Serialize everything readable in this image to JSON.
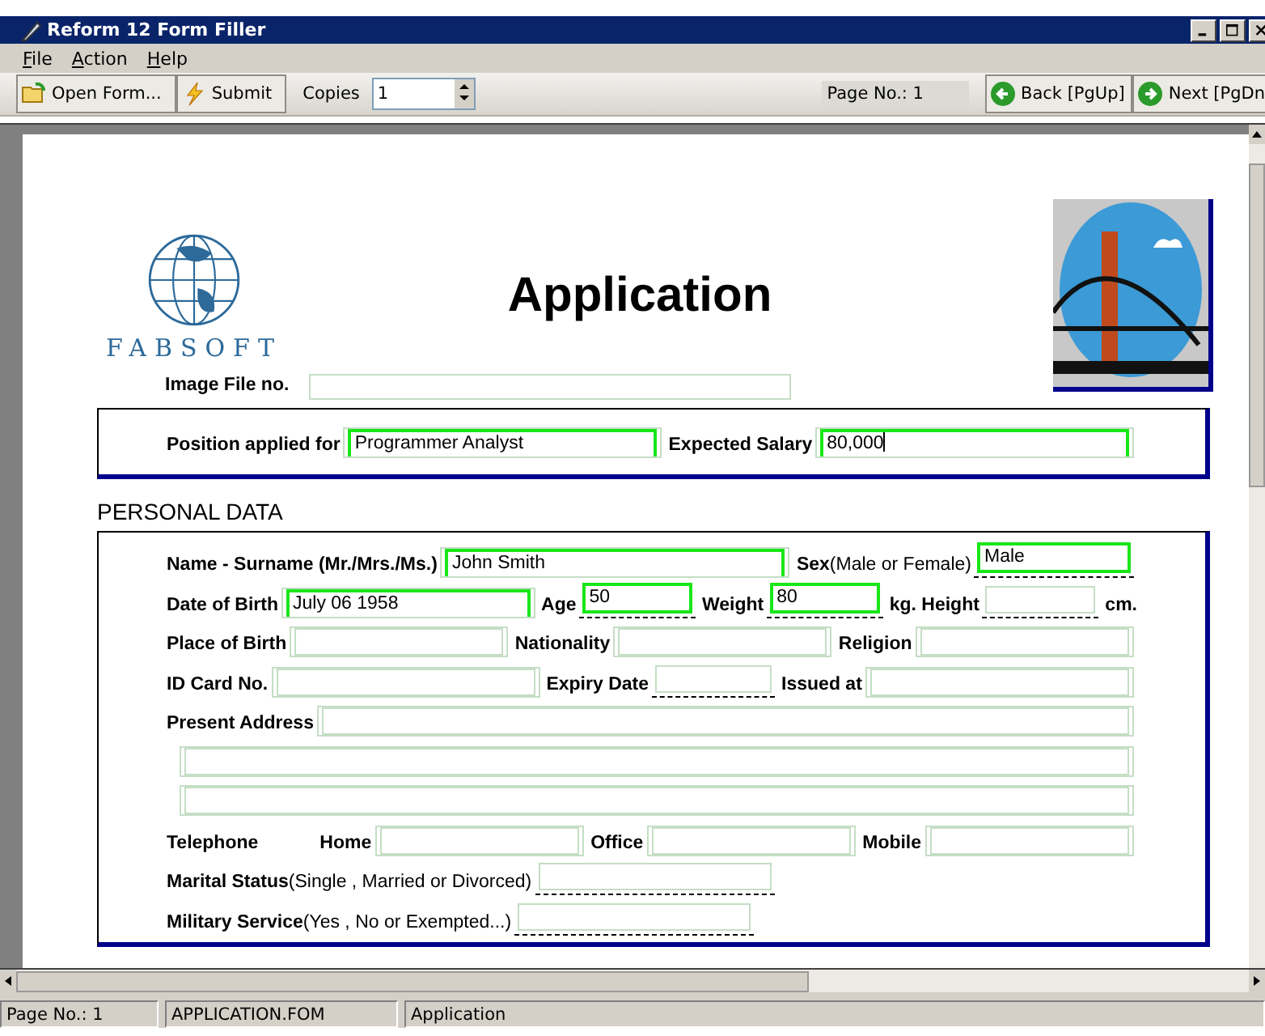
{
  "window": {
    "title": "Reform 12 Form Filler"
  },
  "menu": [
    {
      "label": "File"
    },
    {
      "label": "Action"
    },
    {
      "label": "Help"
    }
  ],
  "toolbar": {
    "open_button": "Open Form...",
    "submit_button": "Submit",
    "copies_label": "Copies",
    "copies_value": "1",
    "page_indicator": "Page No.: 1",
    "back_button": "Back [PgUp]",
    "next_button": "Next [PgDn"
  },
  "form": {
    "logo_text": "FABSOFT",
    "title": "Application",
    "image_file_label": "Image File no.",
    "position_row": [
      {
        "kind": "label",
        "text": "Position applied for"
      },
      {
        "kind": "field",
        "value": "Programmer Analyst"
      },
      {
        "kind": "label",
        "text": "Expected Salary"
      },
      {
        "kind": "field",
        "value": "80,000",
        "cursor": true
      }
    ],
    "section_heading": "PERSONAL DATA",
    "rows": [
      {
        "items": [
          {
            "kind": "label",
            "text": "Name - Surname (Mr./Mrs./Ms.)"
          },
          {
            "kind": "field",
            "value": "John Smith"
          },
          {
            "kind": "label",
            "text": "Sex",
            "note": "(Male or Female)"
          },
          {
            "kind": "small-field",
            "value": "Male"
          }
        ]
      },
      {
        "items": [
          {
            "kind": "label",
            "text": "Date of Birth"
          },
          {
            "kind": "field",
            "value": "July 06 1958"
          },
          {
            "kind": "label",
            "text": "Age"
          },
          {
            "kind": "small-field",
            "value": "50"
          },
          {
            "kind": "label",
            "text": "Weight"
          },
          {
            "kind": "small-field",
            "value": "80"
          },
          {
            "kind": "label",
            "text": "kg.  Height"
          },
          {
            "kind": "small-field"
          },
          {
            "kind": "label",
            "text": "cm."
          }
        ]
      },
      {
        "items": [
          {
            "kind": "label",
            "text": "Place of Birth"
          },
          {
            "kind": "field"
          },
          {
            "kind": "label",
            "text": "Nationality"
          },
          {
            "kind": "field"
          },
          {
            "kind": "label",
            "text": "Religion"
          },
          {
            "kind": "field"
          }
        ]
      },
      {
        "items": [
          {
            "kind": "label",
            "text": "ID Card No."
          },
          {
            "kind": "field"
          },
          {
            "kind": "label",
            "text": "Expiry Date"
          },
          {
            "kind": "small-field"
          },
          {
            "kind": "label",
            "text": "Issued at"
          },
          {
            "kind": "field"
          }
        ]
      },
      {
        "items": [
          {
            "kind": "label",
            "text": "Present Address"
          },
          {
            "kind": "field"
          }
        ]
      },
      {
        "items": [
          {
            "kind": "field"
          }
        ]
      },
      {
        "items": [
          {
            "kind": "field"
          }
        ]
      },
      {
        "items": [
          {
            "kind": "label",
            "text": "Telephone"
          },
          {
            "kind": "label",
            "text": "Home"
          },
          {
            "kind": "field"
          },
          {
            "kind": "label",
            "text": "Office"
          },
          {
            "kind": "field"
          },
          {
            "kind": "label",
            "text": "Mobile"
          },
          {
            "kind": "field"
          }
        ]
      },
      {
        "items": [
          {
            "kind": "label",
            "text": "Marital Status",
            "note": "(Single , Married or Divorced)"
          },
          {
            "kind": "short-field"
          }
        ]
      },
      {
        "items": [
          {
            "kind": "label",
            "text": "Military Service",
            "note": "(Yes , No or Exempted...)"
          },
          {
            "kind": "short-field"
          }
        ]
      }
    ]
  },
  "status_bar": [
    {
      "text": "Page No.: 1"
    },
    {
      "text": "APPLICATION.FOM"
    },
    {
      "text": "Application"
    }
  ]
}
